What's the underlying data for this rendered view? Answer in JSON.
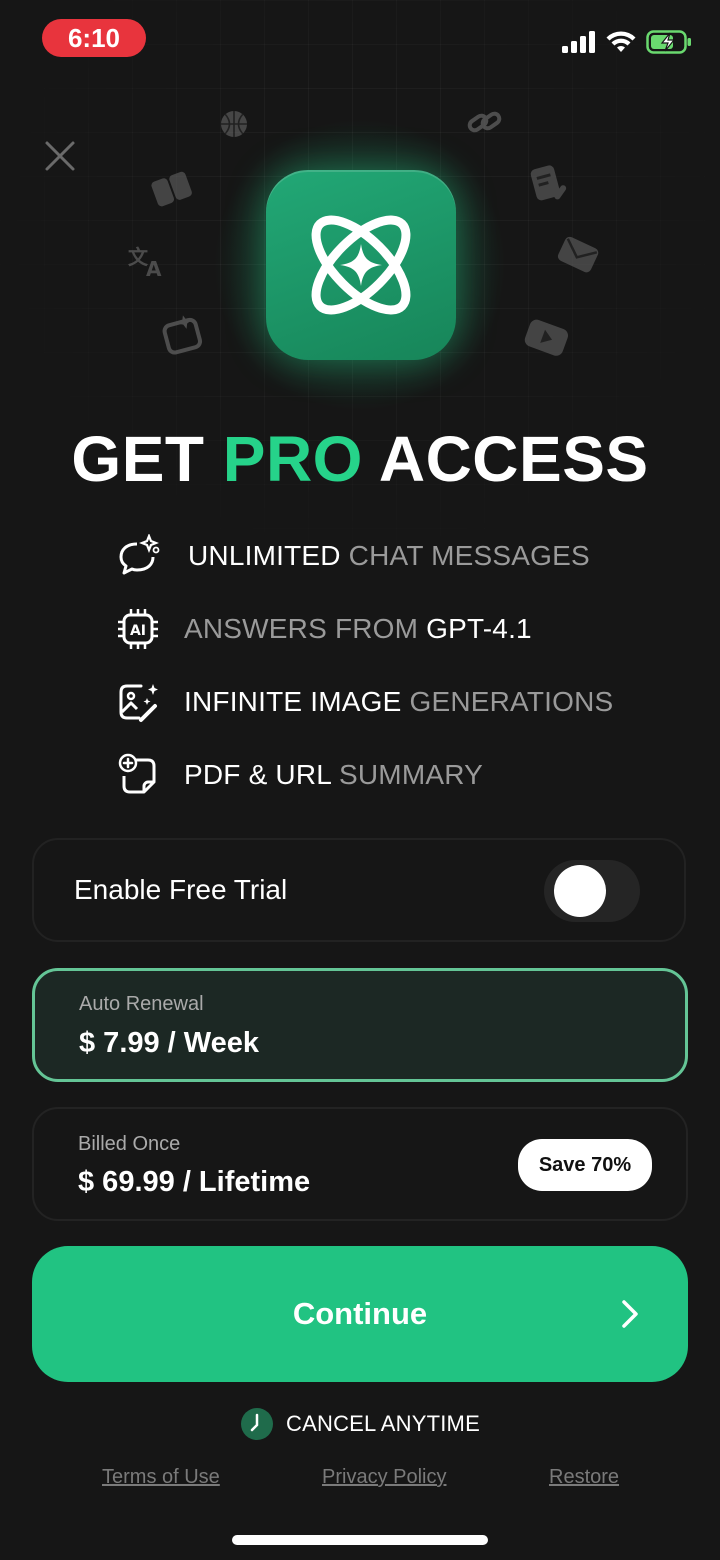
{
  "status_bar": {
    "time": "6:10",
    "icons": [
      "cellular-signal-icon",
      "wifi-icon",
      "battery-charging-icon"
    ],
    "time_pill_color": "#e8343d"
  },
  "header": {
    "close_icon": "close-icon",
    "floating_icons": [
      "basketball-icon",
      "link-icon",
      "book-icon",
      "document-edit-icon",
      "translate-icon",
      "mail-icon",
      "image-sparkle-icon",
      "video-play-icon"
    ],
    "app_icon": "ai-sparkle-logo-icon"
  },
  "headline": {
    "part1": "GET ",
    "part2": "PRO",
    "part3": " ACCESS",
    "accent_color": "#26d38a"
  },
  "features": [
    {
      "icon": "chat-sparkle-icon",
      "bright": "UNLIMITED",
      "dim": " CHAT MESSAGES",
      "order": "bright-first"
    },
    {
      "icon": "ai-chip-icon",
      "dim": "ANSWERS FROM ",
      "bright": "GPT-4.1",
      "order": "dim-first"
    },
    {
      "icon": "image-magic-icon",
      "bright": "INFINITE IMAGE",
      "dim": " GENERATIONS",
      "order": "bright-first"
    },
    {
      "icon": "document-plus-icon",
      "bright": "PDF & URL",
      "dim": " SUMMARY",
      "order": "bright-first"
    }
  ],
  "trial": {
    "label": "Enable Free Trial",
    "enabled": false
  },
  "plans": [
    {
      "subtitle": "Auto Renewal",
      "price": "$ 7.99 / Week",
      "selected": true
    },
    {
      "subtitle": "Billed Once",
      "price": "$ 69.99 / Lifetime",
      "selected": false,
      "badge": "Save 70%"
    }
  ],
  "cta": {
    "label": "Continue",
    "color": "#21c382"
  },
  "cancel": {
    "label": "CANCEL ANYTIME"
  },
  "footer": {
    "terms": "Terms of Use",
    "privacy": "Privacy Policy",
    "restore": "Restore"
  }
}
